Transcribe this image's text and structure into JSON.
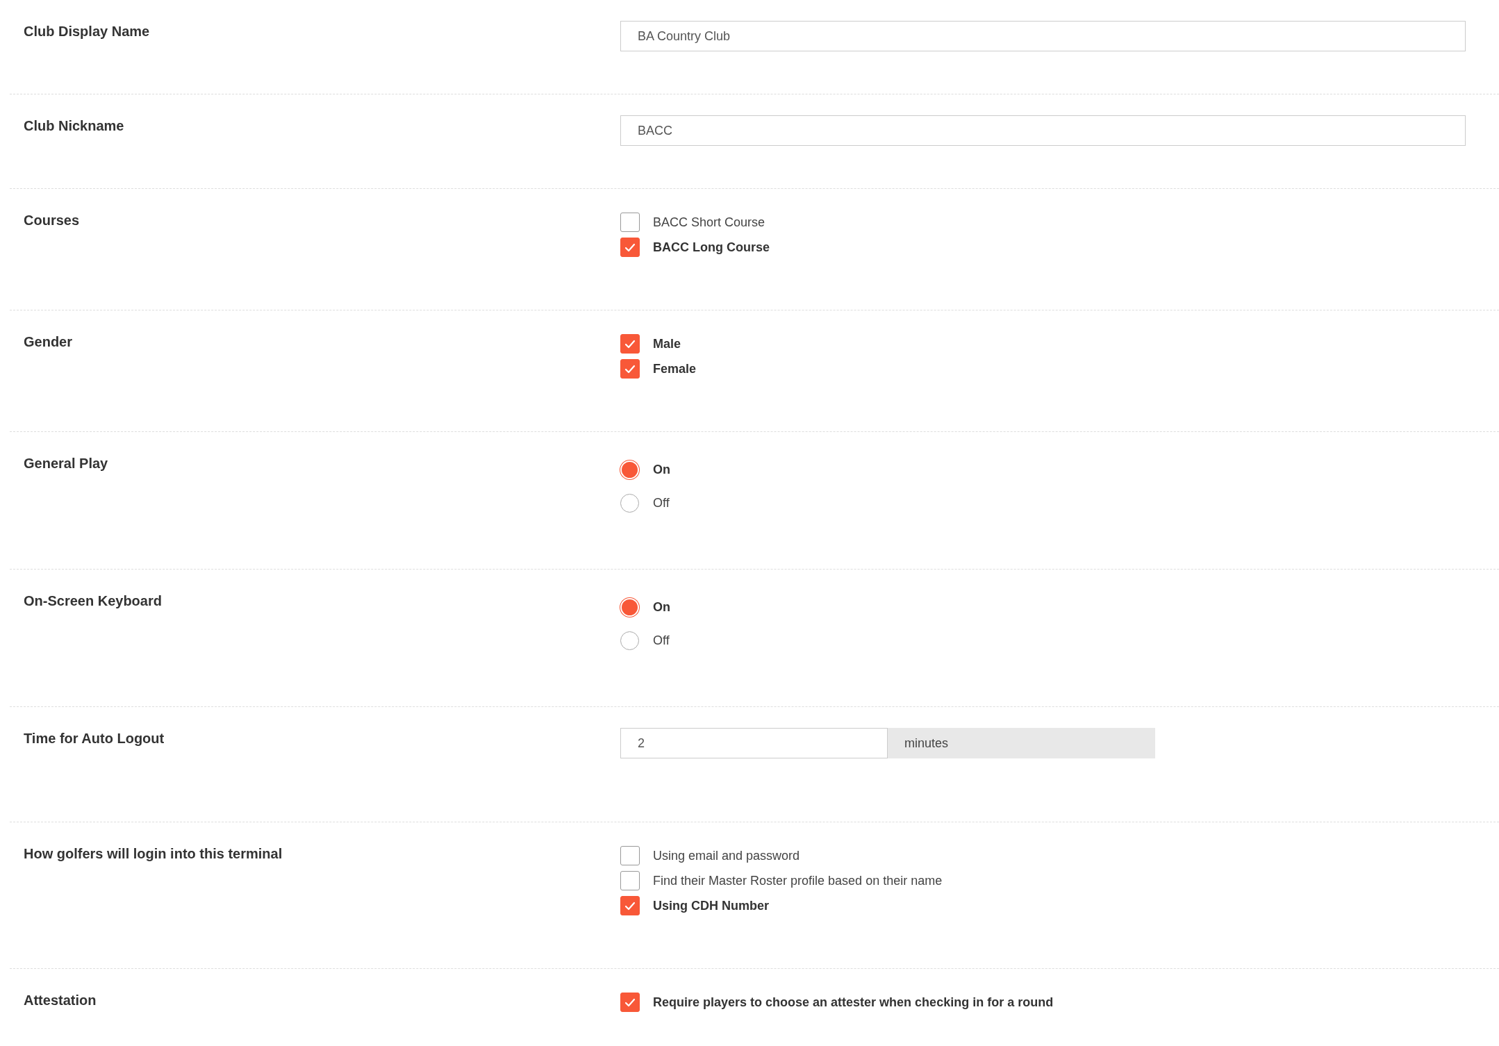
{
  "settings": [
    {
      "kind": "text",
      "label": "Club Display Name",
      "value": "BA Country Club"
    },
    {
      "kind": "text",
      "label": "Club Nickname",
      "value": "BACC"
    },
    {
      "kind": "checklist",
      "label": "Courses",
      "options": [
        {
          "label": "BACC Short Course",
          "checked": false
        },
        {
          "label": "BACC Long Course",
          "checked": true
        }
      ]
    },
    {
      "kind": "checklist",
      "label": "Gender",
      "options": [
        {
          "label": "Male",
          "checked": true
        },
        {
          "label": "Female",
          "checked": true
        }
      ]
    },
    {
      "kind": "radio",
      "label": "General Play",
      "options": [
        {
          "label": "On",
          "selected": true
        },
        {
          "label": "Off",
          "selected": false
        }
      ]
    },
    {
      "kind": "radio",
      "label": "On-Screen Keyboard",
      "options": [
        {
          "label": "On",
          "selected": true
        },
        {
          "label": "Off",
          "selected": false
        }
      ]
    },
    {
      "kind": "addon",
      "label": "Time for Auto Logout",
      "value": "2",
      "unit": "minutes"
    },
    {
      "kind": "checklist",
      "label": "How golfers will login into this terminal",
      "options": [
        {
          "label": "Using email and password",
          "checked": false
        },
        {
          "label": "Find their Master Roster profile based on their name",
          "checked": false
        },
        {
          "label": "Using CDH Number",
          "checked": true
        }
      ]
    },
    {
      "kind": "checklist",
      "label": "Attestation",
      "options": [
        {
          "label": "Require players to choose an attester when checking in for a round",
          "checked": true
        }
      ]
    }
  ]
}
